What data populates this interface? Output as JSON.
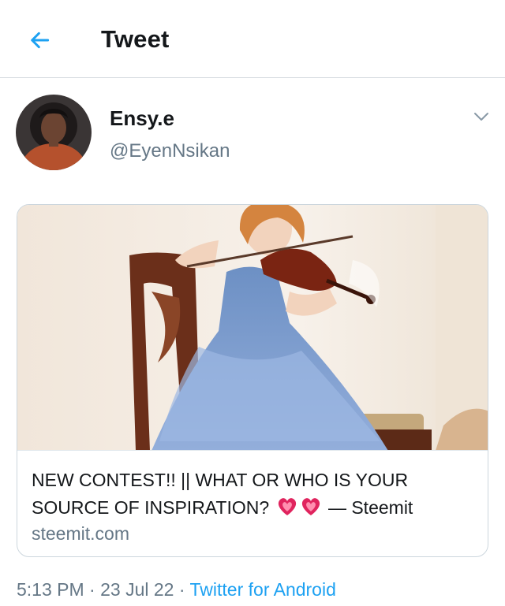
{
  "topbar": {
    "title": "Tweet",
    "back_icon": "arrow-left-icon"
  },
  "author": {
    "display_name": "Ensy.e",
    "handle": "@EyenNsikan",
    "menu_icon": "chevron-down-icon"
  },
  "card": {
    "title_text": "NEW CONTEST!! || WHAT OR WHO IS YOUR SOURCE OF INSPIRATION?",
    "title_emoji": "heart-emoji-pair",
    "title_suffix": "— Steemit",
    "domain": "steemit.com",
    "image": "girl-playing-violin-photo"
  },
  "meta": {
    "time": "5:13 PM",
    "sep1": "·",
    "date": "23 Jul 22",
    "sep2": "·",
    "source": "Twitter for Android"
  },
  "colors": {
    "accent": "#1da1f2",
    "secondary_text": "#657786",
    "primary_text": "#14171a",
    "border": "#ccd6dd"
  }
}
